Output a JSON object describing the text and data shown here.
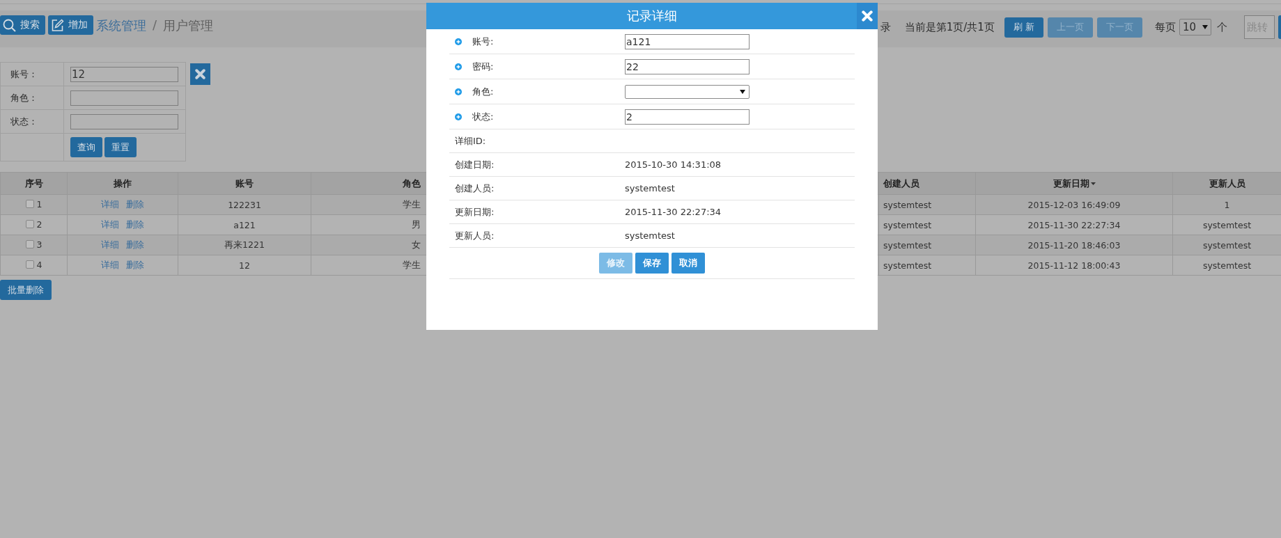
{
  "toolbar": {
    "buttons": [
      {
        "kind": "search",
        "label": "搜索"
      },
      {
        "kind": "add",
        "label": "增加"
      }
    ]
  },
  "breadcrumb": {
    "items": [
      "系统管理",
      "用户管理"
    ],
    "separator": "/"
  },
  "pager": {
    "count_fragment": "录",
    "status": "当前是第1页/共1页",
    "buttons": [
      {
        "label": "刷 新",
        "disabled": false
      },
      {
        "label": "上一页",
        "disabled": true
      },
      {
        "label": "下一页",
        "disabled": true
      }
    ],
    "per_page_label": "每页",
    "per_page": "10",
    "per_page_unit": "个",
    "jump": {
      "placeholder": "跳转"
    }
  },
  "search_form": {
    "fields": [
      {
        "label": "账号：",
        "value": "12"
      },
      {
        "label": "角色："
      },
      {
        "label": "状态："
      }
    ],
    "buttons": [
      "查询",
      "重置"
    ]
  },
  "table": {
    "columns": [
      {
        "label": "序号",
        "sorted": false
      },
      {
        "label": "操作",
        "sorted": false
      },
      {
        "label": "账号",
        "sorted": false
      },
      {
        "label": "角色",
        "sorted": false
      },
      {
        "label": "创建人员",
        "sorted": false
      },
      {
        "label": "更新日期",
        "sorted": true
      },
      {
        "label": "更新人员",
        "sorted": false
      }
    ],
    "rows": [
      {
        "index": "1",
        "checked": false,
        "actions": [
          "详细",
          "删除"
        ],
        "account": "122231",
        "role": "学生",
        "creator": "systemtest",
        "updated": "2015-12-03 16:49:09",
        "updater": "1"
      },
      {
        "index": "2",
        "checked": false,
        "actions": [
          "详细",
          "删除"
        ],
        "account": "a121",
        "role": "男",
        "creator": "systemtest",
        "updated": "2015-11-30 22:27:34",
        "updater": "systemtest"
      },
      {
        "index": "3",
        "checked": false,
        "actions": [
          "详细",
          "删除"
        ],
        "account": "再来1221",
        "role": "女",
        "creator": "systemtest",
        "updated": "2015-11-20 18:46:03",
        "updater": "systemtest"
      },
      {
        "index": "4",
        "checked": false,
        "actions": [
          "详细",
          "删除"
        ],
        "account": "12",
        "role": "学生",
        "creator": "systemtest",
        "updated": "2015-11-12 18:00:43",
        "updater": "systemtest"
      }
    ]
  },
  "batch_delete": "批量删除",
  "modal": {
    "title": "记录详细",
    "rows": [
      {
        "kind": "input",
        "label": "账号:",
        "value": "a121"
      },
      {
        "kind": "input",
        "label": "密码:",
        "value": "22"
      },
      {
        "kind": "select",
        "label": "角色:"
      },
      {
        "kind": "input",
        "label": "状态:",
        "value": "2"
      },
      {
        "kind": "text",
        "label": "详细ID:"
      },
      {
        "kind": "text",
        "label": "创建日期:",
        "value": "2015-10-30 14:31:08"
      },
      {
        "kind": "text",
        "label": "创建人员:",
        "value": "systemtest"
      },
      {
        "kind": "text",
        "label": "更新日期:",
        "value": "2015-11-30 22:27:34"
      },
      {
        "kind": "text",
        "label": "更新人员:",
        "value": "systemtest"
      }
    ],
    "buttons": [
      {
        "label": "修改",
        "disabled": true
      },
      {
        "label": "保存",
        "disabled": false
      },
      {
        "label": "取消",
        "disabled": false
      }
    ]
  }
}
